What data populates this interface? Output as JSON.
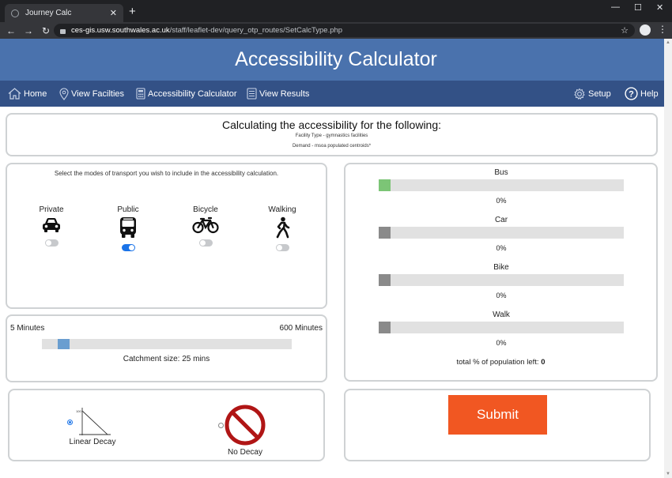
{
  "browser": {
    "tab_title": "Journey Calc",
    "tab_close": "✕",
    "new_tab": "+",
    "url_host": "ces-gis.usw.southwales.ac.uk",
    "url_path": "/staff/leaflet-dev/query_otp_routes/SetCalcType.php"
  },
  "header": {
    "title": "Accessibility Calculator"
  },
  "nav": {
    "home": "Home",
    "view_facilities": "View Facilties",
    "accessibility_calculator": "Accessibility Calculator",
    "view_results": "View Results",
    "setup": "Setup",
    "help": "Help"
  },
  "info": {
    "title": "Calculating the accessibility for the following:",
    "facility_type": "Facility Type - gymnastics facilities",
    "demand": "Demand - msoa populated centroids*"
  },
  "modes": {
    "intro": "Select the modes of transport you wish to include in the accessibility calculation.",
    "items": [
      {
        "label": "Private",
        "enabled": false
      },
      {
        "label": "Public",
        "enabled": true
      },
      {
        "label": "Bicycle",
        "enabled": false
      },
      {
        "label": "Walking",
        "enabled": false
      }
    ]
  },
  "catchment": {
    "min_label": "5 Minutes",
    "max_label": "600 Minutes",
    "min_value": 5,
    "max_value": 600,
    "value": 25,
    "caption": "Catchment size: 25 mins"
  },
  "decay": {
    "linear_label": "Linear Decay",
    "linear_axis_tick": "100",
    "none_label": "No Decay",
    "selected": "linear"
  },
  "results": {
    "bars": [
      {
        "label": "Bus",
        "percent_text": "0%",
        "color": "#7cc576"
      },
      {
        "label": "Car",
        "percent_text": "0%",
        "color": "#8a8a8a"
      },
      {
        "label": "Bike",
        "percent_text": "0%",
        "color": "#8a8a8a"
      },
      {
        "label": "Walk",
        "percent_text": "0%",
        "color": "#8a8a8a"
      }
    ],
    "population_label": "total % of population left:",
    "population_value": "0"
  },
  "submit": {
    "label": "Submit"
  },
  "colors": {
    "header": "#4a72ad",
    "navbar": "#335186",
    "submit": "#f15722",
    "toggle_on": "#1a73e8",
    "slider_thumb": "#6a9ed0",
    "no_decay": "#b01515"
  }
}
